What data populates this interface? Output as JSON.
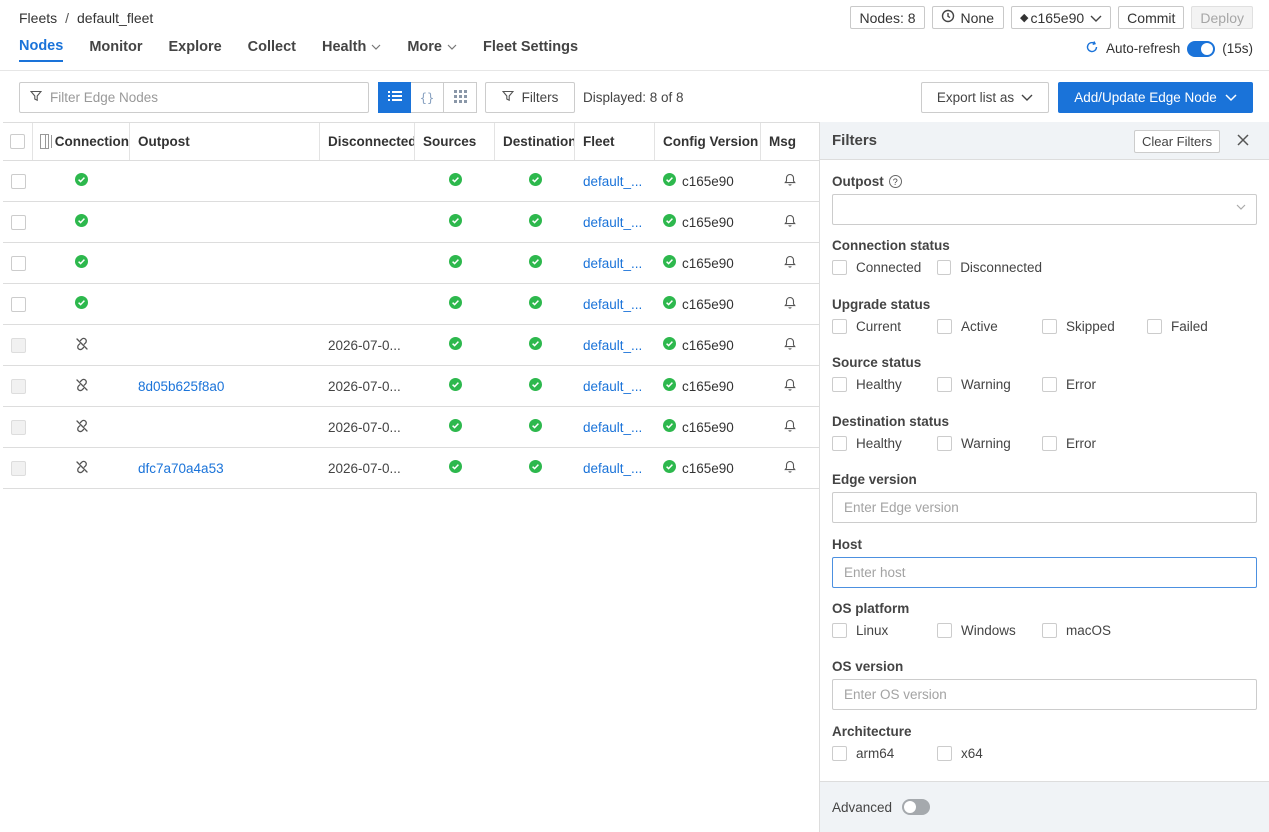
{
  "breadcrumb": {
    "root": "Fleets",
    "separator": "/",
    "current": "default_fleet"
  },
  "top_actions": {
    "nodes": "Nodes: 8",
    "none": "None",
    "commit_id": "c165e90",
    "commit": "Commit",
    "deploy": "Deploy"
  },
  "tabs": [
    {
      "label": "Nodes"
    },
    {
      "label": "Monitor"
    },
    {
      "label": "Explore"
    },
    {
      "label": "Collect"
    },
    {
      "label": "Health"
    },
    {
      "label": "More"
    },
    {
      "label": "Fleet Settings"
    }
  ],
  "auto_refresh": {
    "label": "Auto-refresh",
    "interval": "(15s)"
  },
  "toolbar": {
    "filter_placeholder": "Filter Edge Nodes",
    "filters_label": "Filters",
    "displayed": "Displayed: 8 of 8",
    "export_label": "Export list as",
    "add_label": "Add/Update Edge Node"
  },
  "table": {
    "headers": {
      "connection": "Connection",
      "outpost": "Outpost",
      "disconnected": "Disconnected",
      "sources": "Sources",
      "destinations": "Destinations",
      "fleet": "Fleet",
      "config": "Config Version",
      "msg": "Msg"
    },
    "rows": [
      {
        "connected": true,
        "outpost": "",
        "disconnected": "",
        "fleet": "default_...",
        "config": "c165e90"
      },
      {
        "connected": true,
        "outpost": "",
        "disconnected": "",
        "fleet": "default_...",
        "config": "c165e90"
      },
      {
        "connected": true,
        "outpost": "",
        "disconnected": "",
        "fleet": "default_...",
        "config": "c165e90"
      },
      {
        "connected": true,
        "outpost": "",
        "disconnected": "",
        "fleet": "default_...",
        "config": "c165e90"
      },
      {
        "connected": false,
        "outpost": "",
        "disconnected": "2026-07-0...",
        "fleet": "default_...",
        "config": "c165e90"
      },
      {
        "connected": false,
        "outpost": "8d05b625f8a0",
        "disconnected": "2026-07-0...",
        "fleet": "default_...",
        "config": "c165e90"
      },
      {
        "connected": false,
        "outpost": "",
        "disconnected": "2026-07-0...",
        "fleet": "default_...",
        "config": "c165e90"
      },
      {
        "connected": false,
        "outpost": "dfc7a70a4a53",
        "disconnected": "2026-07-0...",
        "fleet": "default_...",
        "config": "c165e90"
      }
    ]
  },
  "filters_panel": {
    "title": "Filters",
    "clear": "Clear Filters",
    "outpost_label": "Outpost",
    "connection_label": "Connection status",
    "connection_opts": [
      "Connected",
      "Disconnected"
    ],
    "upgrade_label": "Upgrade status",
    "upgrade_opts": [
      "Current",
      "Active",
      "Skipped",
      "Failed"
    ],
    "source_label": "Source status",
    "source_opts": [
      "Healthy",
      "Warning",
      "Error"
    ],
    "dest_label": "Destination status",
    "dest_opts": [
      "Healthy",
      "Warning",
      "Error"
    ],
    "edge_version_label": "Edge version",
    "edge_version_placeholder": "Enter Edge version",
    "host_label": "Host",
    "host_placeholder": "Enter host",
    "os_platform_label": "OS platform",
    "os_platform_opts": [
      "Linux",
      "Windows",
      "macOS"
    ],
    "os_version_label": "OS version",
    "os_version_placeholder": "Enter OS version",
    "arch_label": "Architecture",
    "arch_opts": [
      "arm64",
      "x64"
    ],
    "advanced_label": "Advanced"
  },
  "colors": {
    "accent": "#1a73d9",
    "success": "#2db84d",
    "panel_bg": "#f0f3f6"
  }
}
